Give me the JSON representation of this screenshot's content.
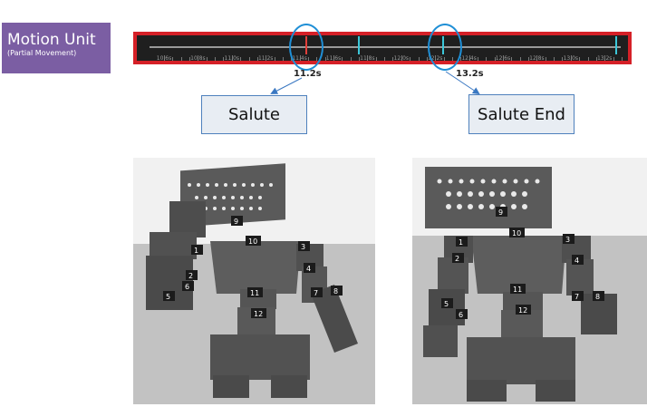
{
  "motion_unit": {
    "title": "Motion Unit",
    "subtitle": "(Partial Movement)"
  },
  "timeline": {
    "tick_labels": [
      "10.6s",
      "10.8s",
      "11.0s",
      "11.2s",
      "11.4s",
      "11.6s",
      "11.8s",
      "12.0s",
      "12.2s",
      "12.4s",
      "12.6s",
      "12.8s",
      "13.0s",
      "13.2s",
      "13.4s"
    ],
    "marker_colors": {
      "playhead": "#e2403a",
      "keyframe": "#3cc7d9",
      "frame_border": "#d52027",
      "callout": "#1f8fd6"
    },
    "markers": [
      "11.2s",
      "13.2s"
    ]
  },
  "callouts": [
    {
      "time": "11.2s",
      "pose": "Salute"
    },
    {
      "time": "13.2s",
      "pose": "Salute End"
    }
  ],
  "robots": {
    "left": {
      "labels": [
        "1",
        "2",
        "3",
        "4",
        "5",
        "6",
        "7",
        "8",
        "9",
        "10",
        "11",
        "12"
      ]
    },
    "right": {
      "labels": [
        "1",
        "2",
        "3",
        "4",
        "5",
        "6",
        "7",
        "8",
        "9",
        "10",
        "11",
        "12"
      ]
    }
  }
}
